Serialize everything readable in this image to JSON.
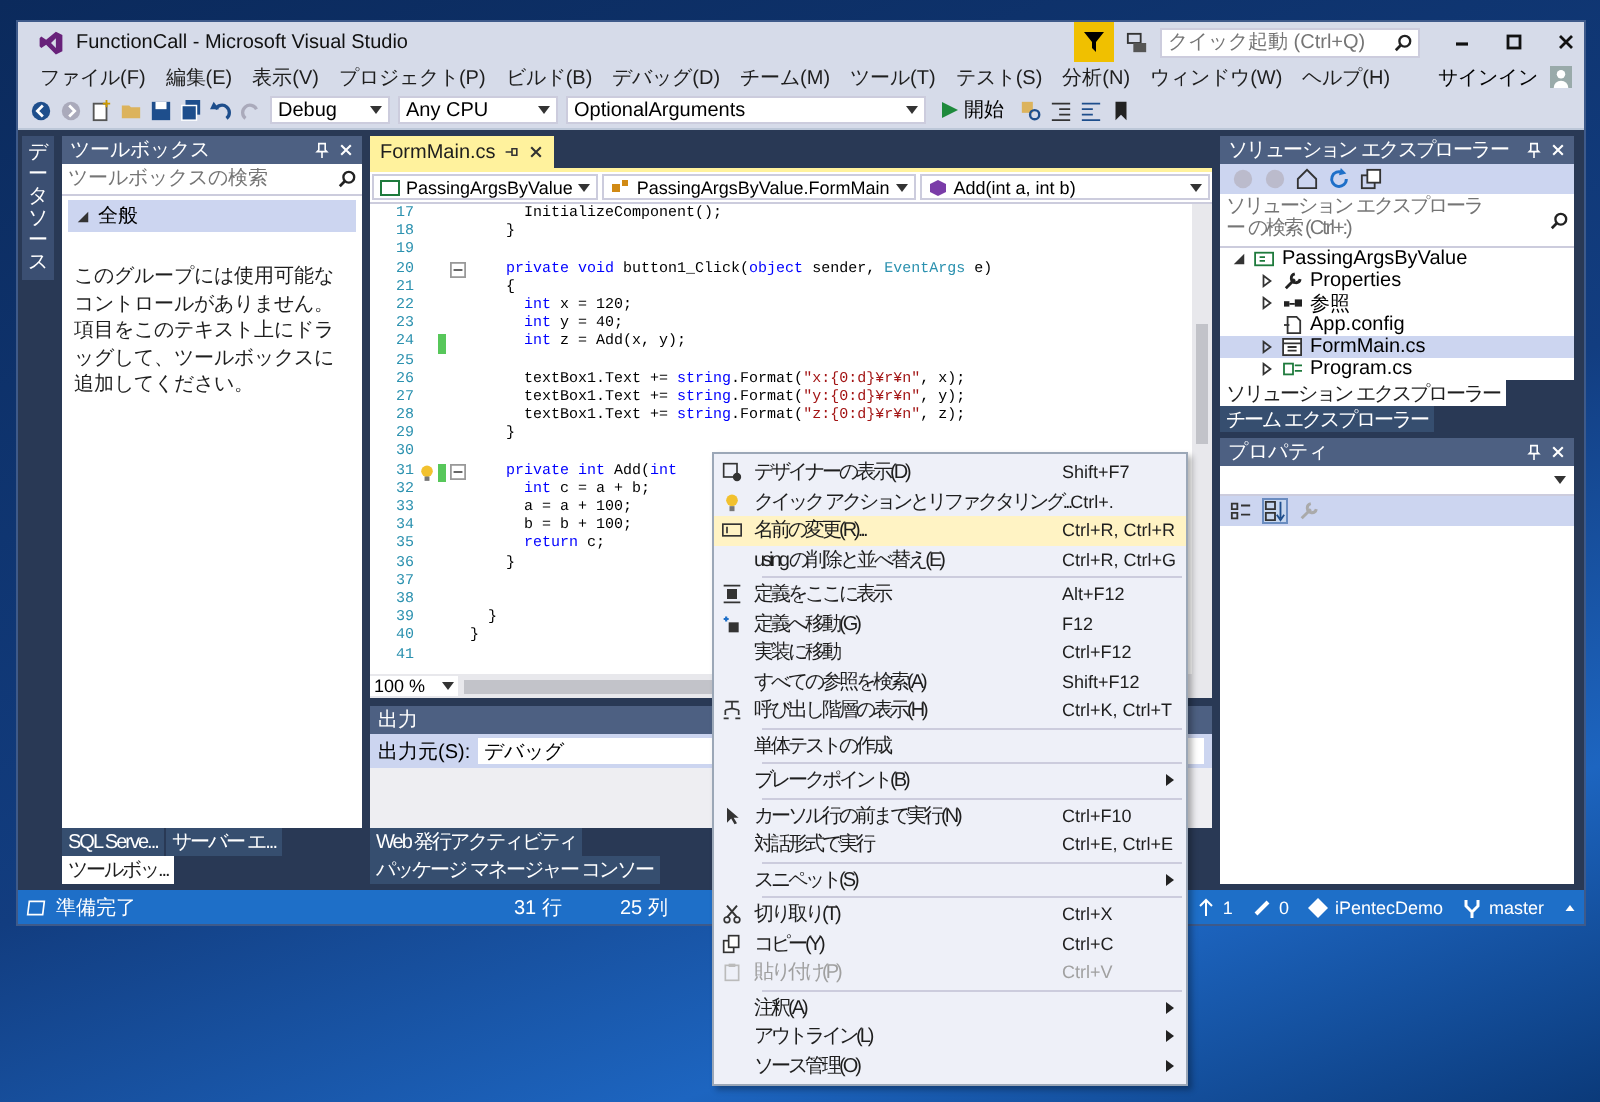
{
  "window": {
    "title": "FunctionCall - Microsoft Visual Studio"
  },
  "quick_launch": {
    "placeholder": "クイック起動 (Ctrl+Q)"
  },
  "menu_bar": {
    "items": [
      "ファイル(F)",
      "編集(E)",
      "表示(V)",
      "プロジェクト(P)",
      "ビルド(B)",
      "デバッグ(D)",
      "チーム(M)",
      "ツール(T)",
      "テスト(S)",
      "分析(N)",
      "ウィンドウ(W)",
      "ヘルプ(H)"
    ],
    "sign_in": "サインイン"
  },
  "toolbar": {
    "configuration": "Debug",
    "platform": "Any CPU",
    "startup_project": "OptionalArguments",
    "start_button": "開始"
  },
  "side_tab": "データソース",
  "toolbox": {
    "title": "ツールボックス",
    "search_placeholder": "ツールボックスの検索",
    "group": {
      "label": "全般",
      "expanded": true
    },
    "message": "このグループには使用可能なコントロールがありません。項目をこのテキスト上にドラッグして、ツールボックスに追加してください。"
  },
  "left_tabs": [
    {
      "label": "SQL Serve...",
      "selected": false
    },
    {
      "label": "サーバー エ...",
      "selected": false
    },
    {
      "label": "ツールボッ...",
      "selected": true
    }
  ],
  "editor": {
    "tabs": [
      {
        "label": "FormMain.cs",
        "selected": true
      }
    ],
    "nav": [
      "PassingArgsByValue",
      "PassingArgsByValue.FormMain",
      "Add(int a, int b)"
    ],
    "zoom": "100 %",
    "lines": [
      {
        "n": "17",
        "segs": [
          {
            "kind": "plain",
            "text": "      InitializeComponent();"
          }
        ],
        "modified": false,
        "fold": false,
        "bulb": false
      },
      {
        "n": "18",
        "segs": [
          {
            "kind": "plain",
            "text": "    }"
          }
        ],
        "modified": false,
        "fold": false,
        "bulb": false
      },
      {
        "n": "19",
        "modified": false,
        "fold": false,
        "bulb": false
      },
      {
        "n": "20",
        "segs": [
          {
            "kind": "keyword",
            "text": "    private"
          },
          {
            "kind": "keyword",
            "text": " void"
          },
          {
            "kind": "plain",
            "text": " button1_Click("
          },
          {
            "kind": "keyword",
            "text": "object"
          },
          {
            "kind": "plain",
            "text": " sender, "
          },
          {
            "kind": "type",
            "text": "EventArgs"
          },
          {
            "kind": "plain",
            "text": " e)"
          }
        ],
        "modified": false,
        "fold": true,
        "bulb": false
      },
      {
        "n": "21",
        "segs": [
          {
            "kind": "plain",
            "text": "    {"
          }
        ],
        "modified": false,
        "fold": false,
        "bulb": false
      },
      {
        "n": "22",
        "segs": [
          {
            "kind": "keyword",
            "text": "      int"
          },
          {
            "kind": "plain",
            "text": " x = 120;"
          }
        ],
        "modified": false,
        "fold": false,
        "bulb": false
      },
      {
        "n": "23",
        "segs": [
          {
            "kind": "keyword",
            "text": "      int"
          },
          {
            "kind": "plain",
            "text": " y = 40;"
          }
        ],
        "modified": false,
        "fold": false,
        "bulb": false
      },
      {
        "n": "24",
        "segs": [
          {
            "kind": "keyword",
            "text": "      int"
          },
          {
            "kind": "plain",
            "text": " z = Add(x, y);"
          }
        ],
        "modified": true,
        "fold": false,
        "bulb": false
      },
      {
        "n": "25",
        "modified": false,
        "fold": false,
        "bulb": false
      },
      {
        "n": "26",
        "segs": [
          {
            "kind": "plain",
            "text": "      textBox1.Text += "
          },
          {
            "kind": "keyword",
            "text": "string"
          },
          {
            "kind": "plain",
            "text": ".Format("
          },
          {
            "kind": "string",
            "text": "\"x:{0:d}¥r¥n\""
          },
          {
            "kind": "plain",
            "text": ", x);"
          }
        ],
        "modified": false,
        "fold": false,
        "bulb": false
      },
      {
        "n": "27",
        "segs": [
          {
            "kind": "plain",
            "text": "      textBox1.Text += "
          },
          {
            "kind": "keyword",
            "text": "string"
          },
          {
            "kind": "plain",
            "text": ".Format("
          },
          {
            "kind": "string",
            "text": "\"y:{0:d}¥r¥n\""
          },
          {
            "kind": "plain",
            "text": ", y);"
          }
        ],
        "modified": false,
        "fold": false,
        "bulb": false
      },
      {
        "n": "28",
        "segs": [
          {
            "kind": "plain",
            "text": "      textBox1.Text += "
          },
          {
            "kind": "keyword",
            "text": "string"
          },
          {
            "kind": "plain",
            "text": ".Format("
          },
          {
            "kind": "string",
            "text": "\"z:{0:d}¥r¥n\""
          },
          {
            "kind": "plain",
            "text": ", z);"
          }
        ],
        "modified": false,
        "fold": false,
        "bulb": false
      },
      {
        "n": "29",
        "segs": [
          {
            "kind": "plain",
            "text": "    }"
          }
        ],
        "modified": false,
        "fold": false,
        "bulb": false
      },
      {
        "n": "30",
        "modified": false,
        "fold": false,
        "bulb": false
      },
      {
        "n": "31",
        "segs": [
          {
            "kind": "keyword",
            "text": "    private"
          },
          {
            "kind": "keyword",
            "text": " int"
          },
          {
            "kind": "plain",
            "text": " Add("
          },
          {
            "kind": "keyword",
            "text": "int"
          }
        ],
        "modified": true,
        "fold": true,
        "bulb": true
      },
      {
        "n": "32",
        "segs": [
          {
            "kind": "keyword",
            "text": "      int"
          },
          {
            "kind": "plain",
            "text": " c = a + b;"
          }
        ],
        "modified": false,
        "fold": false,
        "bulb": false
      },
      {
        "n": "33",
        "segs": [
          {
            "kind": "plain",
            "text": "      a = a + 100;"
          }
        ],
        "modified": false,
        "fold": false,
        "bulb": false
      },
      {
        "n": "34",
        "segs": [
          {
            "kind": "plain",
            "text": "      b = b + 100;"
          }
        ],
        "modified": false,
        "fold": false,
        "bulb": false
      },
      {
        "n": "35",
        "segs": [
          {
            "kind": "keyword",
            "text": "      return"
          },
          {
            "kind": "plain",
            "text": " c;"
          }
        ],
        "modified": false,
        "fold": false,
        "bulb": false
      },
      {
        "n": "36",
        "segs": [
          {
            "kind": "plain",
            "text": "    }"
          }
        ],
        "modified": false,
        "fold": false,
        "bulb": false
      },
      {
        "n": "37",
        "modified": false,
        "fold": false,
        "bulb": false
      },
      {
        "n": "38",
        "modified": false,
        "fold": false,
        "bulb": false
      },
      {
        "n": "39",
        "segs": [
          {
            "kind": "plain",
            "text": "  }"
          }
        ],
        "modified": false,
        "fold": false,
        "bulb": false
      },
      {
        "n": "40",
        "segs": [
          {
            "kind": "plain",
            "text": "}"
          }
        ],
        "modified": false,
        "fold": false,
        "bulb": false
      },
      {
        "n": "41",
        "modified": false,
        "fold": false,
        "bulb": false
      }
    ]
  },
  "output": {
    "title": "出力",
    "source_label": "出力元(S):",
    "source": "デバッグ"
  },
  "bottom_tabs": [
    {
      "label": "Web 発行アクティビティ",
      "selected": false
    },
    {
      "label": "パッケージ マネージャー コンソー",
      "selected": false
    }
  ],
  "solution_explorer": {
    "title": "ソリューション エクスプローラー",
    "search_placeholder": "ソリューション エクスプローラー の検索 (Ctrl+:)",
    "tree": [
      {
        "label": "PassingArgsByValue",
        "kind": "project",
        "expanded": true,
        "selected": false,
        "children": [
          {
            "label": "Properties",
            "kind": "properties",
            "expanded": false,
            "selected": false
          },
          {
            "label": "参照",
            "kind": "references",
            "expanded": false,
            "selected": false
          },
          {
            "label": "App.config",
            "kind": "config",
            "selected": false
          },
          {
            "label": "FormMain.cs",
            "kind": "form",
            "expanded": false,
            "selected": true
          },
          {
            "label": "Program.cs",
            "kind": "csharp",
            "expanded": false,
            "selected": false
          }
        ]
      }
    ]
  },
  "right_tabs": [
    {
      "label": "ソリューション エクスプローラー",
      "selected": true
    },
    {
      "label": "チーム エクスプローラー",
      "selected": false
    }
  ],
  "properties": {
    "title": "プロパティ"
  },
  "status_bar": {
    "message": "準備完了",
    "line": "31 行",
    "column": "25 列",
    "pushes": "1",
    "changes": "0",
    "repository": "iPentecDemo",
    "branch": "master"
  },
  "context_menu": {
    "groups": [
      [
        {
          "label": "デザイナーの表示(D)",
          "shortcut": "Shift+F7",
          "selected": false,
          "disabled": false,
          "submenu": false
        },
        {
          "label": "クイック アクションとリファクタリング...",
          "shortcut": "Ctrl+.",
          "selected": false,
          "disabled": false,
          "submenu": false
        },
        {
          "label": "名前の変更(R)...",
          "shortcut": "Ctrl+R, Ctrl+R",
          "selected": true,
          "disabled": false,
          "submenu": false
        },
        {
          "label": "using の削除と並べ替え(E)",
          "shortcut": "Ctrl+R, Ctrl+G",
          "selected": false,
          "disabled": false,
          "submenu": false
        }
      ],
      [
        {
          "label": "定義をここに表示",
          "shortcut": "Alt+F12",
          "selected": false,
          "disabled": false,
          "submenu": false
        },
        {
          "label": "定義へ移動(G)",
          "shortcut": "F12",
          "selected": false,
          "disabled": false,
          "submenu": false
        },
        {
          "label": "実装に移動",
          "shortcut": "Ctrl+F12",
          "selected": false,
          "disabled": false,
          "submenu": false
        },
        {
          "label": "すべての参照を検索(A)",
          "shortcut": "Shift+F12",
          "selected": false,
          "disabled": false,
          "submenu": false
        },
        {
          "label": "呼び出し階層の表示(H)",
          "shortcut": "Ctrl+K, Ctrl+T",
          "selected": false,
          "disabled": false,
          "submenu": false
        }
      ],
      [
        {
          "label": "単体テストの作成",
          "selected": false,
          "disabled": false,
          "submenu": false
        }
      ],
      [
        {
          "label": "ブレークポイント(B)",
          "selected": false,
          "disabled": false,
          "submenu": true
        }
      ],
      [
        {
          "label": "カーソル行の前まで実行(N)",
          "shortcut": "Ctrl+F10",
          "selected": false,
          "disabled": false,
          "submenu": false
        },
        {
          "label": "対話形式で実行",
          "shortcut": "Ctrl+E, Ctrl+E",
          "selected": false,
          "disabled": false,
          "submenu": false
        }
      ],
      [
        {
          "label": "スニペット(S)",
          "selected": false,
          "disabled": false,
          "submenu": true
        }
      ],
      [
        {
          "label": "切り取り(T)",
          "shortcut": "Ctrl+X",
          "selected": false,
          "disabled": false,
          "submenu": false
        },
        {
          "label": "コピー(Y)",
          "shortcut": "Ctrl+C",
          "selected": false,
          "disabled": false,
          "submenu": false
        },
        {
          "label": "貼り付け(P)",
          "shortcut": "Ctrl+V",
          "selected": false,
          "disabled": true,
          "submenu": false
        }
      ],
      [
        {
          "label": "注釈(A)",
          "selected": false,
          "disabled": false,
          "submenu": true
        },
        {
          "label": "アウトライン(L)",
          "selected": false,
          "disabled": false,
          "submenu": true
        },
        {
          "label": "ソース管理(O)",
          "selected": false,
          "disabled": false,
          "submenu": true
        }
      ]
    ]
  }
}
